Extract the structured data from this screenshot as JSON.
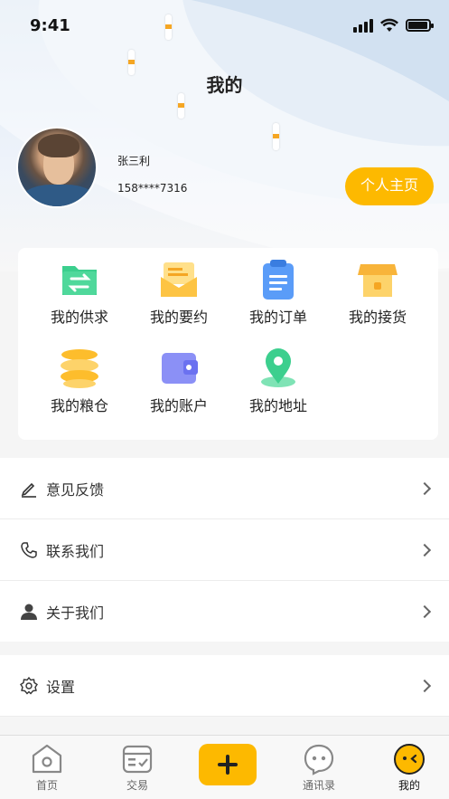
{
  "status_bar": {
    "time": "9:41"
  },
  "header": {
    "title": "我的"
  },
  "profile": {
    "name": "张三利",
    "phone": "158****7316",
    "home_button": "个人主页"
  },
  "grid": [
    {
      "label": "我的供求",
      "icon": "supply-demand-icon",
      "color": "#3ccf8e"
    },
    {
      "label": "我的要约",
      "icon": "offer-envelope-icon",
      "color": "#fdc444"
    },
    {
      "label": "我的订单",
      "icon": "order-clipboard-icon",
      "color": "#5a9cf8"
    },
    {
      "label": "我的接货",
      "icon": "store-receive-icon",
      "color": "#f8b43a"
    },
    {
      "label": "我的粮仓",
      "icon": "granary-icon",
      "color": "#fdbd2c"
    },
    {
      "label": "我的账户",
      "icon": "wallet-icon",
      "color": "#7b80f4"
    },
    {
      "label": "我的地址",
      "icon": "location-pin-icon",
      "color": "#3ccf8e"
    }
  ],
  "menu": [
    {
      "label": "意见反馈",
      "icon": "edit-icon"
    },
    {
      "label": "联系我们",
      "icon": "phone-icon"
    },
    {
      "label": "关于我们",
      "icon": "user-icon"
    },
    {
      "label": "设置",
      "icon": "gear-icon"
    }
  ],
  "tabs": [
    {
      "label": "首页",
      "icon": "home-icon"
    },
    {
      "label": "交易",
      "icon": "trade-icon"
    },
    {
      "label": "通讯录",
      "icon": "contacts-chat-icon"
    },
    {
      "label": "我的",
      "icon": "profile-face-icon",
      "active": true
    }
  ],
  "colors": {
    "accent": "#fdb900"
  }
}
